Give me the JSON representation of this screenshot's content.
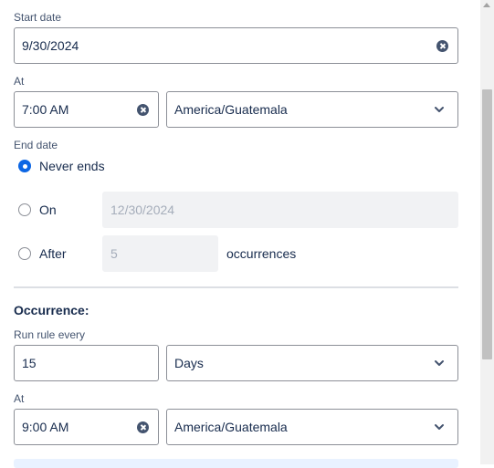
{
  "start": {
    "label": "Start date",
    "date_value": "9/30/2024"
  },
  "start_at": {
    "label": "At",
    "time_value": "7:00 AM",
    "timezone": "America/Guatemala"
  },
  "end": {
    "label": "End date",
    "options": [
      {
        "label": "Never ends",
        "checked": true
      },
      {
        "label": "On",
        "checked": false,
        "value": "12/30/2024"
      },
      {
        "label": "After",
        "checked": false,
        "value": "5",
        "suffix": "occurrences"
      }
    ]
  },
  "occurrence": {
    "heading": "Occurrence:",
    "run_label": "Run rule every",
    "every_value": "15",
    "unit": "Days",
    "at_label": "At",
    "time_value": "9:00 AM",
    "timezone": "America/Guatemala"
  },
  "icons": {
    "clear": "clear-icon",
    "dropdown": "chevron-down-icon"
  },
  "colors": {
    "accent": "#0c66e4",
    "border": "#8c8f97",
    "disabled_bg": "#f1f2f4"
  }
}
